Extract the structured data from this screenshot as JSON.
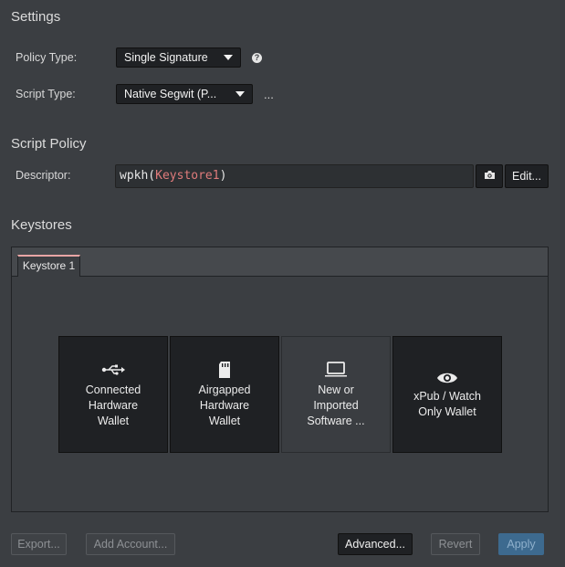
{
  "settings": {
    "title": "Settings",
    "policy_type_label": "Policy Type:",
    "policy_type_value": "Single Signature",
    "help_glyph": "?",
    "script_type_label": "Script Type:",
    "script_type_value": "Native Segwit (P...",
    "script_type_more": "..."
  },
  "script_policy": {
    "title": "Script Policy",
    "descriptor_label": "Descriptor:",
    "descriptor_prefix": "wpkh(",
    "descriptor_keystore": "Keystore1",
    "descriptor_suffix": ")",
    "edit_label": "Edit..."
  },
  "keystores": {
    "title": "Keystores",
    "tab_label": "Keystore 1",
    "options": [
      {
        "label": "Connected\nHardware\nWallet",
        "icon": "usb-icon"
      },
      {
        "label": "Airgapped\nHardware\nWallet",
        "icon": "sd-card-icon"
      },
      {
        "label": "New or\nImported\nSoftware ...",
        "icon": "laptop-icon"
      },
      {
        "label": "xPub / Watch\nOnly Wallet",
        "icon": "eye-icon"
      }
    ]
  },
  "footer": {
    "export_label": "Export...",
    "add_account_label": "Add Account...",
    "advanced_label": "Advanced...",
    "revert_label": "Revert",
    "apply_label": "Apply"
  },
  "colors": {
    "background": "#3b3e42",
    "control_dark": "#1f2124",
    "keystore_accent": "#e07b7b",
    "apply_button": "#3d6a8f"
  }
}
